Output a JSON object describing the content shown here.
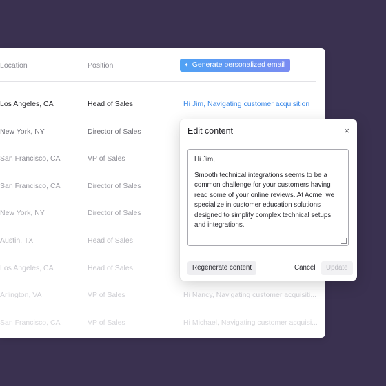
{
  "table": {
    "headers": {
      "location": "Location",
      "position": "Position"
    },
    "generate_button": {
      "label": "Generate personalized email"
    },
    "rows": [
      {
        "location": "Los Angeles, CA",
        "position": "Head of Sales",
        "email": "Hi Jim, Navigating customer acquisition"
      },
      {
        "location": "New York, NY",
        "position": "Director of Sales",
        "email": ""
      },
      {
        "location": "San Francisco, CA",
        "position": "VP of Sales",
        "email": ""
      },
      {
        "location": "San Francisco, CA",
        "position": "Director of Sales",
        "email": ""
      },
      {
        "location": "New York, NY",
        "position": "Director of Sales",
        "email": ""
      },
      {
        "location": "Austin, TX",
        "position": "Head of Sales",
        "email": ""
      },
      {
        "location": "Los Angeles, CA",
        "position": "Head of Sales",
        "email": ""
      },
      {
        "location": "Arlington, VA",
        "position": "VP of Sales",
        "email": "Hi Nancy, Navigating customer acquisiti..."
      },
      {
        "location": "San Francisco, CA",
        "position": "VP of Sales",
        "email": "Hi Michael, Navigating customer acquisi..."
      }
    ]
  },
  "modal": {
    "title": "Edit content",
    "close_label": "×",
    "greeting": "Hi Jim,",
    "body": "Smooth technical integrations seems to be a common challenge for your customers having read some of your online reviews. At Acme, we specialize in customer education solutions designed to simplify complex technical setups and integrations.",
    "regenerate_label": "Regenerate content",
    "cancel_label": "Cancel",
    "update_label": "Update"
  },
  "colors": {
    "background": "#3a3150",
    "accent": "#3d8ae8"
  }
}
